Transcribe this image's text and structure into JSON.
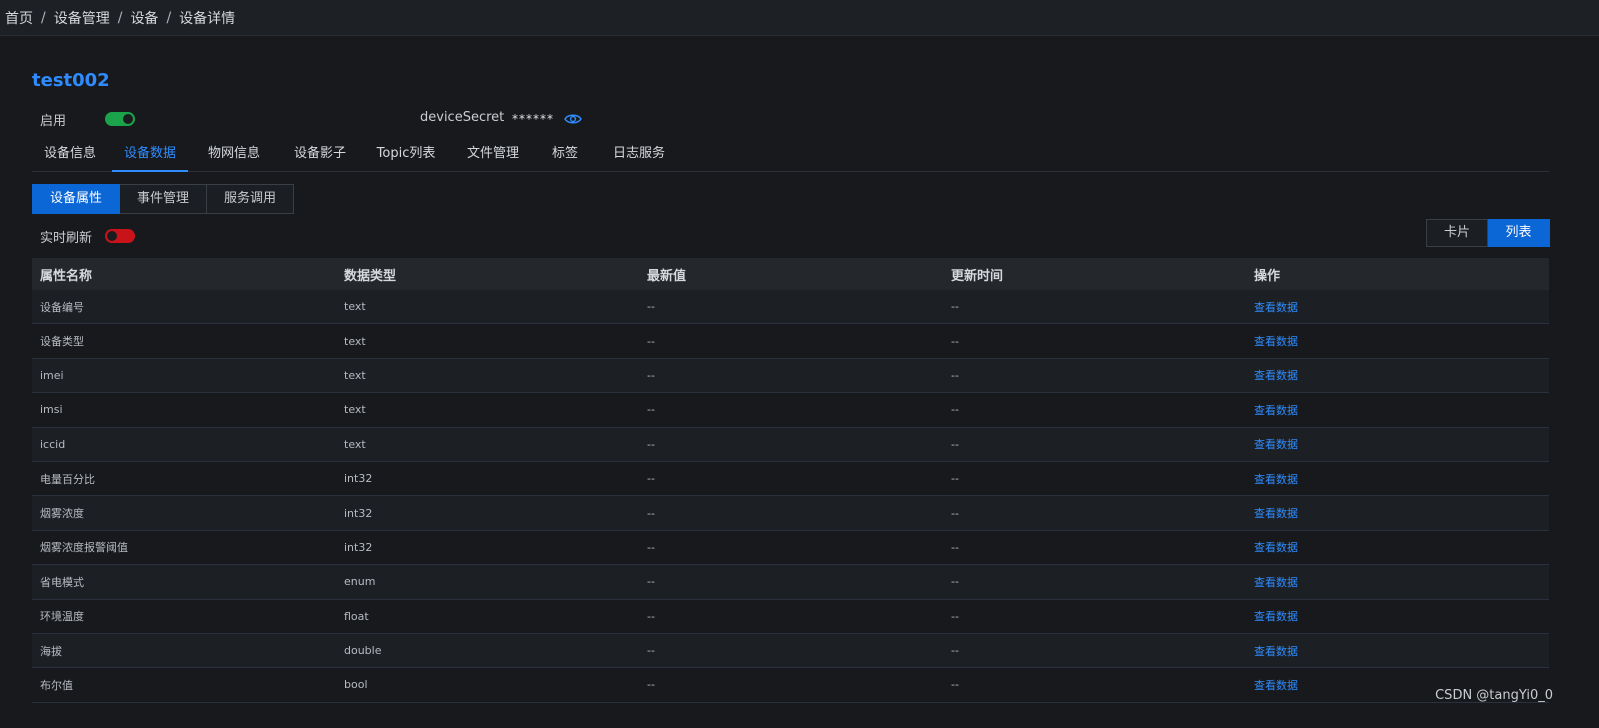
{
  "breadcrumb": {
    "items": [
      "首页",
      "设备管理",
      "设备",
      "设备详情"
    ],
    "separator": "/"
  },
  "device": {
    "name": "test002",
    "enable_label": "启用",
    "enabled": true,
    "secret_label": "deviceSecret",
    "secret_value": "******"
  },
  "tabs": [
    {
      "label": "设备信息",
      "active": false
    },
    {
      "label": "设备数据",
      "active": true
    },
    {
      "label": "物网信息",
      "active": false
    },
    {
      "label": "设备影子",
      "active": false
    },
    {
      "label": "Topic列表",
      "active": false
    },
    {
      "label": "文件管理",
      "active": false
    },
    {
      "label": "标签",
      "active": false
    },
    {
      "label": "日志服务",
      "active": false
    }
  ],
  "subtabs": [
    {
      "label": "设备属性",
      "active": true
    },
    {
      "label": "事件管理",
      "active": false
    },
    {
      "label": "服务调用",
      "active": false
    }
  ],
  "realtime": {
    "label": "实时刷新",
    "enabled": false
  },
  "view_toggle": {
    "card_label": "卡片",
    "list_label": "列表",
    "active": "list"
  },
  "table": {
    "headers": [
      "属性名称",
      "数据类型",
      "最新值",
      "更新时间",
      "操作"
    ],
    "rows": [
      {
        "name": "设备编号",
        "type": "text",
        "value": "--",
        "time": "--",
        "action": "查看数据"
      },
      {
        "name": "设备类型",
        "type": "text",
        "value": "--",
        "time": "--",
        "action": "查看数据"
      },
      {
        "name": "imei",
        "type": "text",
        "value": "--",
        "time": "--",
        "action": "查看数据"
      },
      {
        "name": "imsi",
        "type": "text",
        "value": "--",
        "time": "--",
        "action": "查看数据"
      },
      {
        "name": "iccid",
        "type": "text",
        "value": "--",
        "time": "--",
        "action": "查看数据"
      },
      {
        "name": "电量百分比",
        "type": "int32",
        "value": "--",
        "time": "--",
        "action": "查看数据"
      },
      {
        "name": "烟雾浓度",
        "type": "int32",
        "value": "--",
        "time": "--",
        "action": "查看数据"
      },
      {
        "name": "烟雾浓度报警阈值",
        "type": "int32",
        "value": "--",
        "time": "--",
        "action": "查看数据"
      },
      {
        "name": "省电模式",
        "type": "enum",
        "value": "--",
        "time": "--",
        "action": "查看数据"
      },
      {
        "name": "环境温度",
        "type": "float",
        "value": "--",
        "time": "--",
        "action": "查看数据"
      },
      {
        "name": "海拔",
        "type": "double",
        "value": "--",
        "time": "--",
        "action": "查看数据"
      },
      {
        "name": "布尔值",
        "type": "bool",
        "value": "--",
        "time": "--",
        "action": "查看数据"
      }
    ]
  },
  "watermark": "CSDN @tangYi0_0",
  "colors": {
    "accent": "#2f8cff",
    "primary_button": "#0b66d6",
    "switch_on": "#1aa34a",
    "switch_off": "#c8131a",
    "background": "#17191c"
  },
  "icons": {
    "secret_toggle": "eye-icon"
  }
}
